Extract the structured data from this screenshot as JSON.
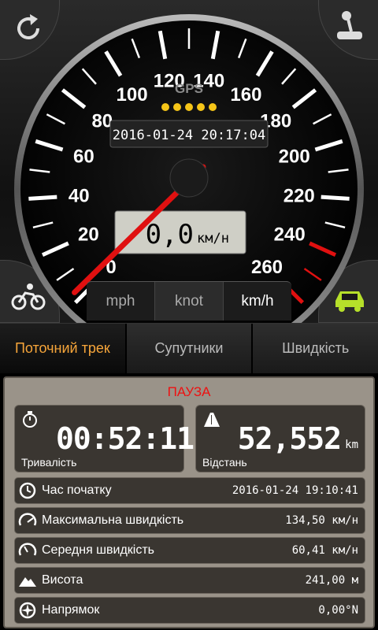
{
  "gauge": {
    "gps_label": "GPS",
    "datetime": "2016-01-24 20:17:04",
    "speed_value": "0,0",
    "speed_unit": "км/н",
    "ticks": [
      "0",
      "20",
      "40",
      "60",
      "80",
      "100",
      "120",
      "140",
      "160",
      "180",
      "200",
      "220",
      "240",
      "260"
    ],
    "current_speed": 0,
    "accent_color": "#e01010"
  },
  "units": {
    "mph": "mph",
    "knot": "knot",
    "kmh": "km/h",
    "active": "kmh"
  },
  "icons": {
    "top_left": "refresh-icon",
    "top_right": "joystick-icon",
    "bottom_left": "bicycle-icon",
    "bottom_right": "car-icon",
    "car_color": "#b6e02a"
  },
  "tabs": [
    {
      "label": "Поточний трек"
    },
    {
      "label": "Супутники"
    },
    {
      "label": "Швидкість"
    }
  ],
  "panel": {
    "status": "ПАУЗА",
    "duration": {
      "value": "00:52:11",
      "label": "Тривалість"
    },
    "distance": {
      "value": "52,552",
      "unit": "km",
      "label": "Відстань"
    },
    "rows": [
      {
        "label": "Час початку",
        "value": "2016-01-24 19:10:41"
      },
      {
        "label": "Максимальна швидкість",
        "value": "134,50 км/н"
      },
      {
        "label": "Середня швидкість",
        "value": "60,41 км/н"
      },
      {
        "label": "Висота",
        "value": "241,00 м"
      },
      {
        "label": "Напрямок",
        "value": "0,00°N"
      }
    ]
  }
}
